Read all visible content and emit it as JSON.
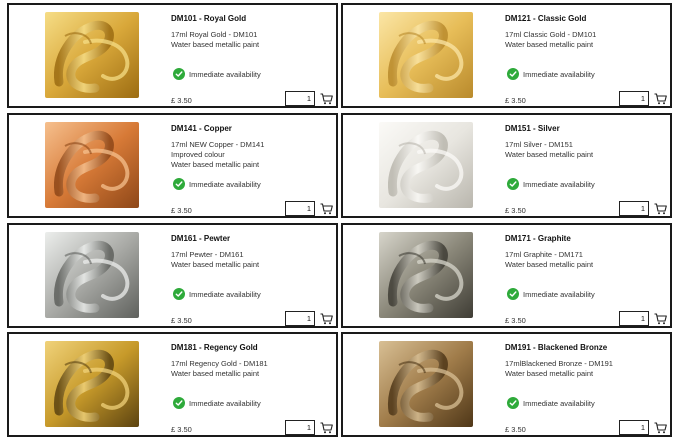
{
  "products": [
    {
      "code_title": "DM101 - Royal Gold",
      "desc_lines": [
        "17ml Royal Gold - DM101",
        "Water based metallic paint"
      ],
      "availability": "Immediate availability",
      "price": "£ 3.50",
      "qty": "1",
      "swatch": {
        "base": "#d9a83a",
        "light": "#f6dd86",
        "dark": "#9c6c12"
      }
    },
    {
      "code_title": "DM121 - Classic Gold",
      "desc_lines": [
        "17ml Classic Gold - DM101",
        "Water based metallic paint"
      ],
      "availability": "Immediate availability",
      "price": "£ 3.50",
      "qty": "1",
      "swatch": {
        "base": "#e7bd58",
        "light": "#fbe6a6",
        "dark": "#b98a2c"
      }
    },
    {
      "code_title": "DM141 - Copper",
      "desc_lines": [
        "17ml NEW Copper - DM141",
        "Improved colour",
        "Water based metallic paint"
      ],
      "availability": "Immediate availability",
      "price": "£ 3.50",
      "qty": "1",
      "swatch": {
        "base": "#d77a37",
        "light": "#f6c08e",
        "dark": "#8e4718"
      }
    },
    {
      "code_title": "DM151 - Silver",
      "desc_lines": [
        "17ml Silver - DM151",
        "Water based metallic paint"
      ],
      "availability": "Immediate availability",
      "price": "£ 3.50",
      "qty": "1",
      "swatch": {
        "base": "#e8e6e0",
        "light": "#fbfaf7",
        "dark": "#b9b6ad"
      }
    },
    {
      "code_title": "DM161 - Pewter",
      "desc_lines": [
        "17ml Pewter - DM161",
        "Water based metallic paint"
      ],
      "availability": "Immediate availability",
      "price": "£ 3.50",
      "qty": "1",
      "swatch": {
        "base": "#a9aaa6",
        "light": "#eceeec",
        "dark": "#5f615d"
      }
    },
    {
      "code_title": "DM171 - Graphite",
      "desc_lines": [
        "17ml Graphite - DM171",
        "Water based metallic paint"
      ],
      "availability": "Immediate availability",
      "price": "£ 3.50",
      "qty": "1",
      "swatch": {
        "base": "#8a8779",
        "light": "#d7d5cb",
        "dark": "#3f3d35"
      }
    },
    {
      "code_title": "DM181 - Regency Gold",
      "desc_lines": [
        "17ml Regency Gold - DM181",
        "Water based metallic paint"
      ],
      "availability": "Immediate availability",
      "price": "£ 3.50",
      "qty": "1",
      "swatch": {
        "base": "#c79a2a",
        "light": "#f0d27a",
        "dark": "#5c4310"
      }
    },
    {
      "code_title": "DM191 - Blackened Bronze",
      "desc_lines": [
        "17mlBlackened Bronze - DM191",
        "Water based metallic paint"
      ],
      "availability": "Immediate availability",
      "price": "£ 3.50",
      "qty": "1",
      "swatch": {
        "base": "#a07c4a",
        "light": "#d8bf94",
        "dark": "#4f3718"
      }
    }
  ],
  "icons": {
    "availability": "check-circle-icon",
    "cart": "shopping-cart-icon"
  },
  "colors": {
    "check_green": "#2eaa3a",
    "card_border": "#1a1a1a"
  }
}
